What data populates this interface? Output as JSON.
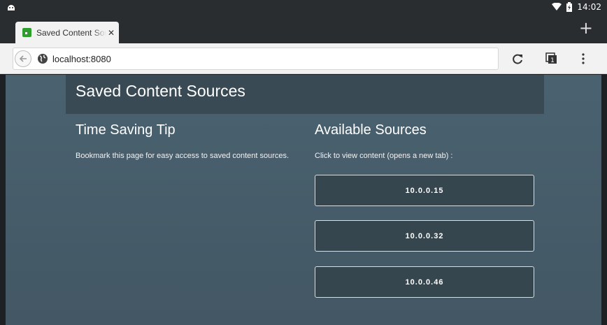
{
  "status_bar": {
    "time": "14:02"
  },
  "tab": {
    "title": "Saved Content Sources"
  },
  "toolbar": {
    "url": "localhost:8080"
  },
  "page": {
    "header": "Saved Content Sources",
    "tip": {
      "heading": "Time Saving Tip",
      "text": "Bookmark this page for easy access to saved content sources."
    },
    "sources": {
      "heading": "Available Sources",
      "instruction": "Click to view content (opens a new tab) :",
      "items": [
        {
          "label": "10.0.0.15"
        },
        {
          "label": "10.0.0.32"
        },
        {
          "label": "10.0.0.46"
        }
      ]
    }
  },
  "colors": {
    "page_bg": "#4a6270",
    "header_bg": "#394a55",
    "button_bg": "#36464f",
    "favicon": "#2e9e2e"
  }
}
